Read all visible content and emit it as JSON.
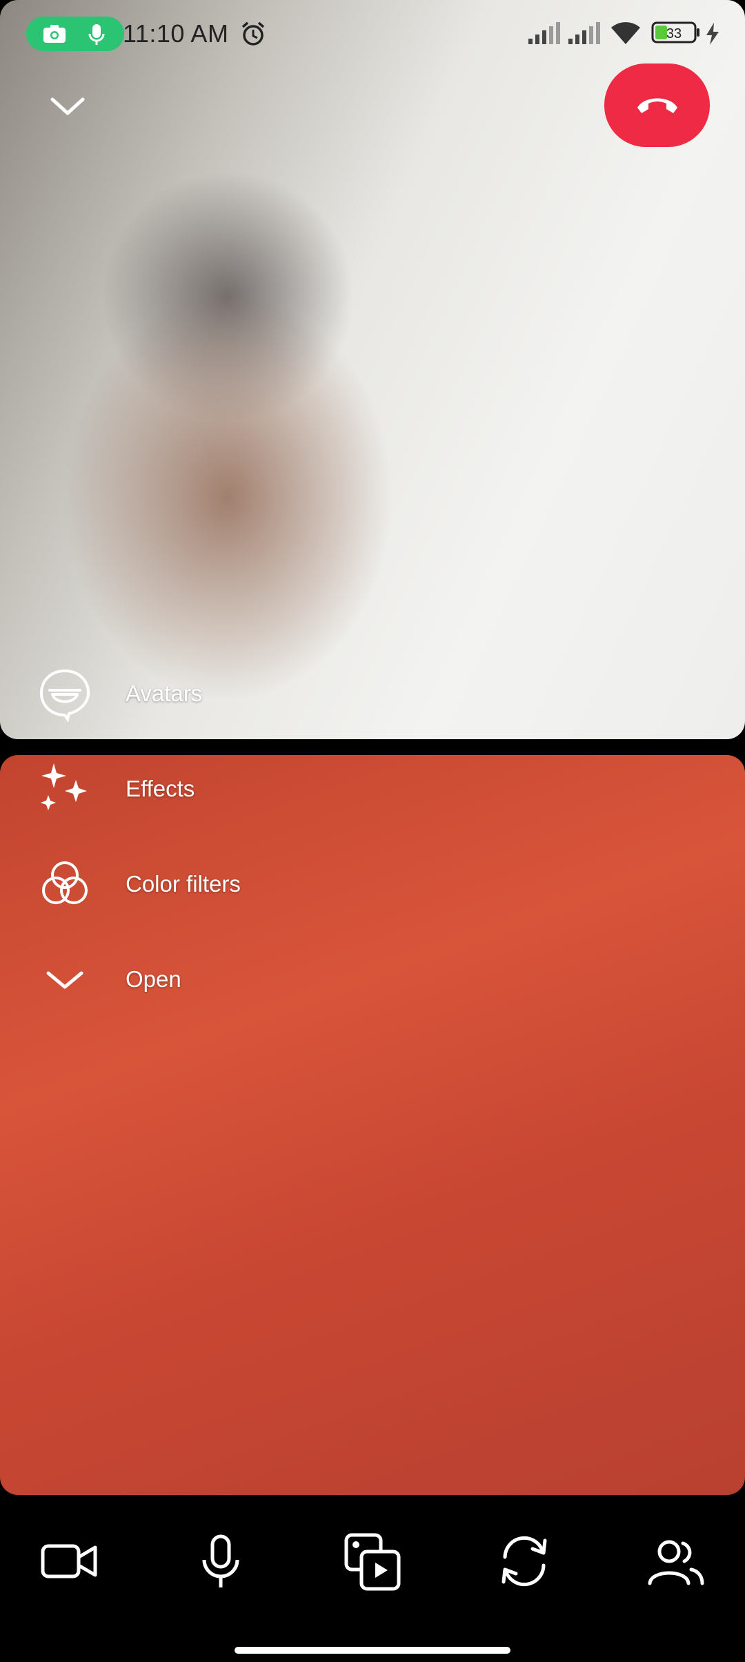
{
  "status_bar": {
    "time": "11:10 AM",
    "battery": "33",
    "icons": [
      "camera-in-use-icon",
      "mic-in-use-icon",
      "alarm-icon",
      "signal-icon",
      "signal-icon",
      "wifi-icon",
      "battery-icon",
      "charging-icon"
    ]
  },
  "call": {
    "collapse_icon": "chevron-down-icon",
    "end_call_icon": "end-call-icon",
    "end_call_color": "#ef2a44"
  },
  "effects_menu": {
    "items": [
      {
        "label": "Avatars",
        "icon": "avatar-icon"
      },
      {
        "label": "Effects",
        "icon": "sparkles-icon"
      },
      {
        "label": "Color filters",
        "icon": "color-filter-icon"
      },
      {
        "label": "Open",
        "icon": "chevron-down-icon"
      }
    ]
  },
  "controls": {
    "items": [
      "video-camera-icon",
      "microphone-icon",
      "media-share-icon",
      "flip-camera-icon",
      "participants-icon"
    ]
  }
}
